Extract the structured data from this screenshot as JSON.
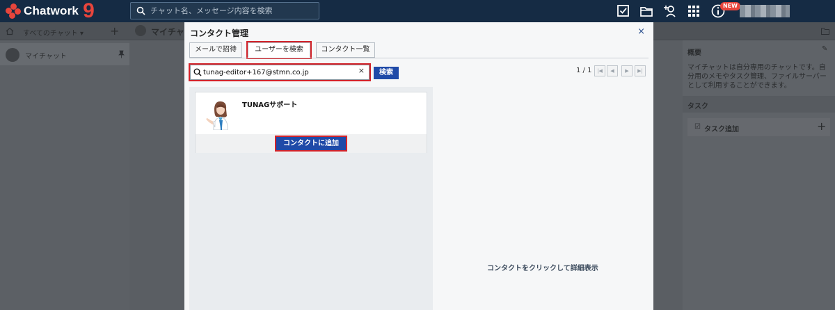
{
  "app": {
    "brand": "Chatwork",
    "search_placeholder": "チャット名、メッセージ内容を検索",
    "new_badge": "NEW"
  },
  "background": {
    "filter_label": "すべてのチャット ▾",
    "room_name": "マイチャット",
    "header_title": "マイチャ",
    "summary_heading": "概要",
    "summary_text": "マイチャットは自分専用のチャットです。自分用のメモやタスク管理、ファイルサーバーとして利用することができます。",
    "task_heading": "タスク",
    "task_add": "タスク追加"
  },
  "modal": {
    "title": "コンタクト管理",
    "close": "×",
    "tabs": [
      {
        "label": "メールで招待"
      },
      {
        "label": "ユーザーを検索"
      },
      {
        "label": "コンタクト一覧"
      }
    ],
    "search_value": "tunag-editor+167@stmn.co.jp",
    "clear": "×",
    "search_button": "検索",
    "page_indicator": "1 / 1",
    "results": [
      {
        "name": "TUNAGサポート",
        "add_button": "コンタクトに追加"
      }
    ],
    "detail_placeholder": "コンタクトをクリックして詳細表示"
  },
  "colors": {
    "topbar": "#152b44",
    "brand_red": "#e8453c",
    "primary_button": "#1f4aa8",
    "highlight": "#d3232a"
  }
}
